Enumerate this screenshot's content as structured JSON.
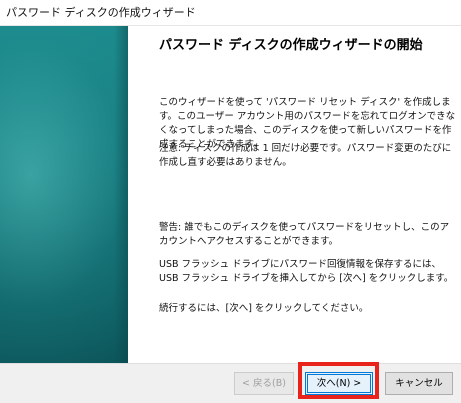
{
  "window": {
    "title": "パスワード ディスクの作成ウィザード"
  },
  "content": {
    "heading": "パスワード ディスクの作成ウィザードの開始",
    "paragraphs": [
      "このウィザードを使って 'パスワード リセット ディスク' を作成します。このユーザー アカウント用のパスワードを忘れてログオンできなくなってしまった場合、このディスクを使って新しいパスワードを作成することができます。",
      "注意: ディスクの作成は 1 回だけ必要です。パスワード変更のたびに作成し直す必要はありません。",
      "警告: 誰でもこのディスクを使ってパスワードをリセットし、このアカウントへアクセスすることができます。",
      "USB フラッシュ ドライブにパスワード回復情報を保存するには、USB フラッシュ ドライブを挿入してから [次へ] をクリックします。",
      "続行するには、[次へ] をクリックしてください。"
    ]
  },
  "buttons": {
    "back": "< 戻る(B)",
    "next": "次へ(N) >",
    "cancel": "キャンセル"
  },
  "colors": {
    "side_panel": "#14797d",
    "highlight": "#e8231c",
    "default_button_border": "#0078d7"
  }
}
